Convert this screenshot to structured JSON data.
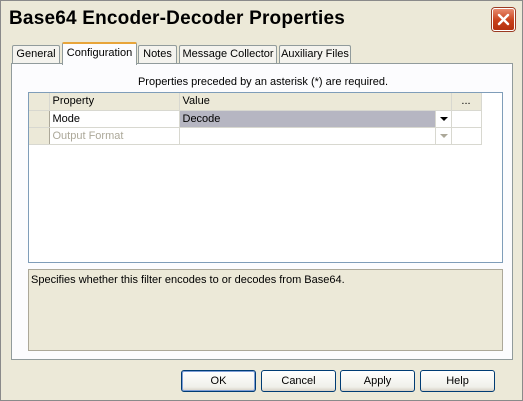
{
  "window": {
    "title": "Base64 Encoder-Decoder Properties"
  },
  "tabs": [
    {
      "label": "General"
    },
    {
      "label": "Configuration"
    },
    {
      "label": "Notes"
    },
    {
      "label": "Message Collector"
    },
    {
      "label": "Auxiliary Files"
    }
  ],
  "active_tab": "Configuration",
  "panel": {
    "required_note": "Properties preceded by an asterisk (*) are required.",
    "grid": {
      "headers": {
        "property": "Property",
        "value": "Value",
        "ellipsis": "..."
      },
      "rows": [
        {
          "property": "Mode",
          "value": "Decode",
          "enabled": true
        },
        {
          "property": "Output Format",
          "value": "",
          "enabled": false
        }
      ]
    },
    "description": "Specifies whether this filter encodes to or decodes from Base64."
  },
  "buttons": {
    "ok": "OK",
    "cancel": "Cancel",
    "apply": "Apply",
    "help": "Help"
  },
  "colors": {
    "window_bg": "#ece9d8",
    "selected_value_bg": "#b6b6c2",
    "close_button": "#c8401a",
    "active_tab_accent": "#e8a53a",
    "disabled_text": "#aca899"
  },
  "icons": {
    "close": "close-icon",
    "dropdown": "chevron-down-icon"
  }
}
